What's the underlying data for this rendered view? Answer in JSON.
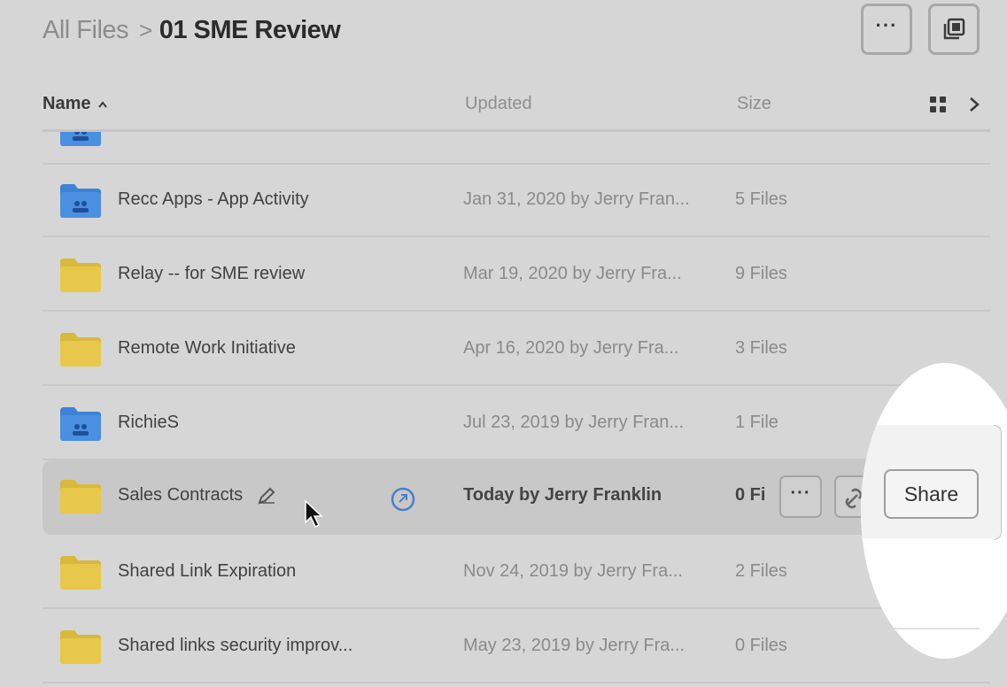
{
  "breadcrumb": {
    "root": "All Files",
    "separator": ">",
    "current": "01 SME Review"
  },
  "header_buttons": {
    "more_label": "···"
  },
  "columns": {
    "name": "Name",
    "updated": "Updated",
    "size": "Size"
  },
  "rows": [
    {
      "name": "Recc Apps - App Activity",
      "updated": "Jan 31, 2020 by Jerry Fran...",
      "size": "5 Files",
      "folder_type": "collaborated-folder"
    },
    {
      "name": "Relay -- for SME review",
      "updated": "Mar 19, 2020 by Jerry Fra...",
      "size": "9 Files",
      "folder_type": "folder"
    },
    {
      "name": "Remote Work Initiative",
      "updated": "Apr 16, 2020 by Jerry Fra...",
      "size": "3 Files",
      "folder_type": "folder"
    },
    {
      "name": "RichieS",
      "updated": "Jul 23, 2019 by Jerry Fran...",
      "size": "1 File",
      "folder_type": "collaborated-folder"
    },
    {
      "name": "Sales Contracts",
      "updated": "Today by Jerry Franklin",
      "size": "0 Fi",
      "folder_type": "folder",
      "selected": true
    },
    {
      "name": "Shared Link Expiration",
      "updated": "Nov 24, 2019 by Jerry Fra...",
      "size": "2 Files",
      "folder_type": "folder"
    },
    {
      "name": "Shared links security improv...",
      "updated": "May 23, 2019 by Jerry Fra...",
      "size": "0 Files",
      "folder_type": "folder"
    }
  ],
  "row_actions": {
    "more_label": "···",
    "share_label": "Share"
  },
  "colors": {
    "background": "#d6d6d6",
    "folder_yellow": "#e8c84a",
    "folder_blue": "#3d82d4",
    "collab_blue": "#4a7fc8",
    "highlight": "#ffffff"
  }
}
